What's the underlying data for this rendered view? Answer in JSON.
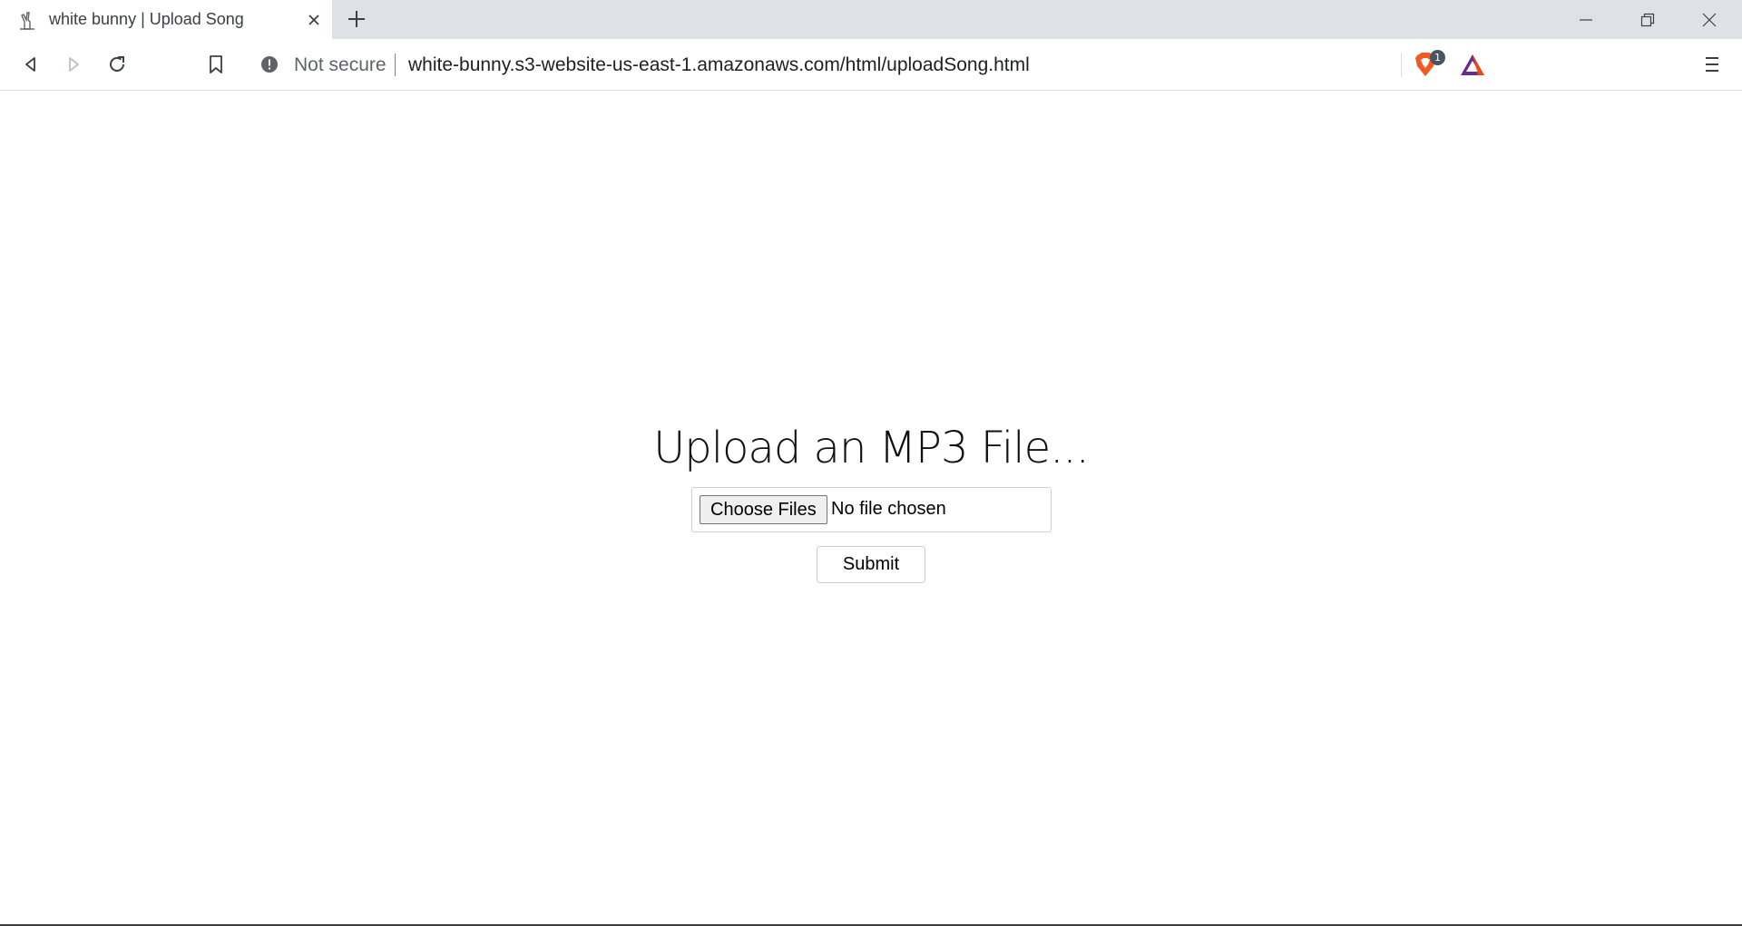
{
  "browser": {
    "tab": {
      "title": "white bunny | Upload Song",
      "favicon": "bunny-favicon"
    },
    "omnibox": {
      "security_label": "Not secure",
      "url": "white-bunny.s3-website-us-east-1.amazonaws.com/html/uploadSong.html",
      "shield_badge_count": "1"
    },
    "icons": {
      "back": "back-arrow-icon",
      "forward": "forward-arrow-icon",
      "reload": "reload-icon",
      "bookmark": "bookmark-icon",
      "info": "info-icon",
      "shield": "brave-shield-icon",
      "rewards": "bat-rewards-icon",
      "menu": "hamburger-menu-icon",
      "new_tab": "plus-icon",
      "close_tab": "close-icon",
      "minimize": "minimize-icon",
      "maximize": "restore-icon",
      "close_window": "close-window-icon"
    },
    "colors": {
      "tabstrip_bg": "#dee1e6",
      "shield_orange": "#f15a22",
      "bat_purple": "#662d91",
      "bat_orange": "#ff5000"
    }
  },
  "page": {
    "heading": "Upload an MP3 File...",
    "file_input": {
      "button_label": "Choose Files",
      "status": "No file chosen"
    },
    "submit_label": "Submit"
  }
}
